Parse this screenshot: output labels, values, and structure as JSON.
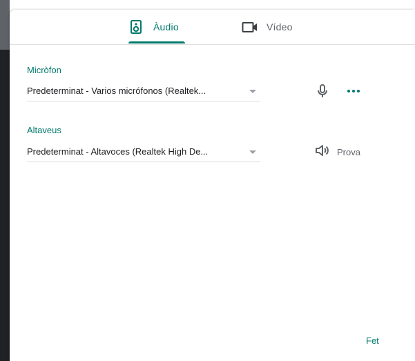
{
  "tabs": [
    {
      "label": "Àudio",
      "icon": "speaker-icon",
      "selected": true
    },
    {
      "label": "Vídeo",
      "icon": "video-camera-icon",
      "selected": false
    }
  ],
  "microphone": {
    "label": "Micròfon",
    "selected_value": "Predeterminat - Varios micrófonos (Realtek...",
    "mic_icon": "microphone-icon",
    "more_icon": "more-horizontal-icon"
  },
  "speakers": {
    "label": "Altaveus",
    "selected_value": "Predeterminat - Altavoces (Realtek High De...",
    "test_label": "Prova",
    "test_icon": "volume-icon"
  },
  "footer": {
    "done_label": "Fet"
  },
  "colors": {
    "accent": "#00796b",
    "text_primary": "#202124",
    "text_secondary": "#5f6368",
    "divider": "#e0e0e0"
  }
}
